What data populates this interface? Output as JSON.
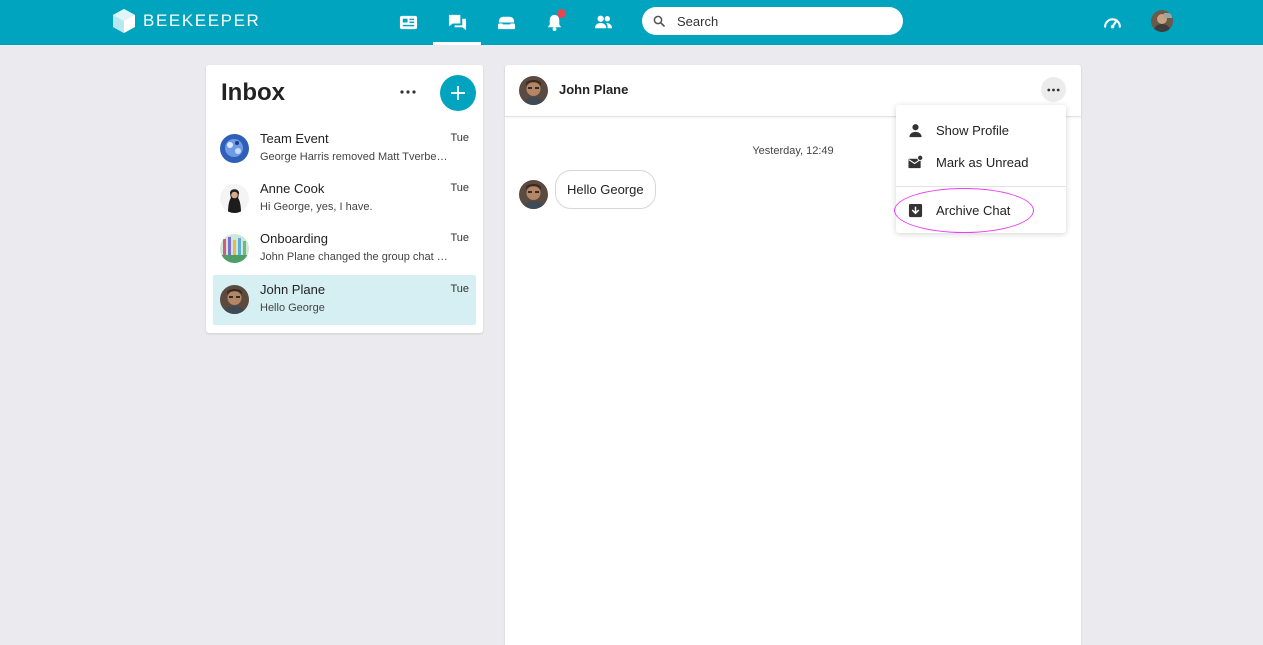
{
  "app": {
    "brand": "BEEKEEPER",
    "accent": "#00a4bf",
    "notification_dot": "#e5484d",
    "highlight": "#ea3ef0"
  },
  "topbar": {
    "nav_icons": [
      "news-icon",
      "chat-icon",
      "tools-icon",
      "bell-icon",
      "people-icon"
    ],
    "search_placeholder": "Search"
  },
  "inbox": {
    "title": "Inbox",
    "chats": [
      {
        "name": "Team Event",
        "day": "Tue",
        "preview": "George Harris removed Matt Tverbe…"
      },
      {
        "name": "Anne Cook",
        "day": "Tue",
        "preview": "Hi George, yes, I have."
      },
      {
        "name": "Onboarding",
        "day": "Tue",
        "preview": "John Plane changed the group chat …"
      },
      {
        "name": "John Plane",
        "day": "Tue",
        "preview": "Hello George"
      }
    ]
  },
  "conversation": {
    "name": "John Plane",
    "timestamp": "Yesterday, 12:49",
    "messages": [
      {
        "text": "Hello George"
      }
    ]
  },
  "menu": {
    "items": [
      {
        "label": "Show Profile",
        "icon": "person-icon"
      },
      {
        "label": "Mark as Unread",
        "icon": "mail-unread-icon"
      },
      {
        "label": "Archive Chat",
        "icon": "archive-icon"
      }
    ]
  }
}
